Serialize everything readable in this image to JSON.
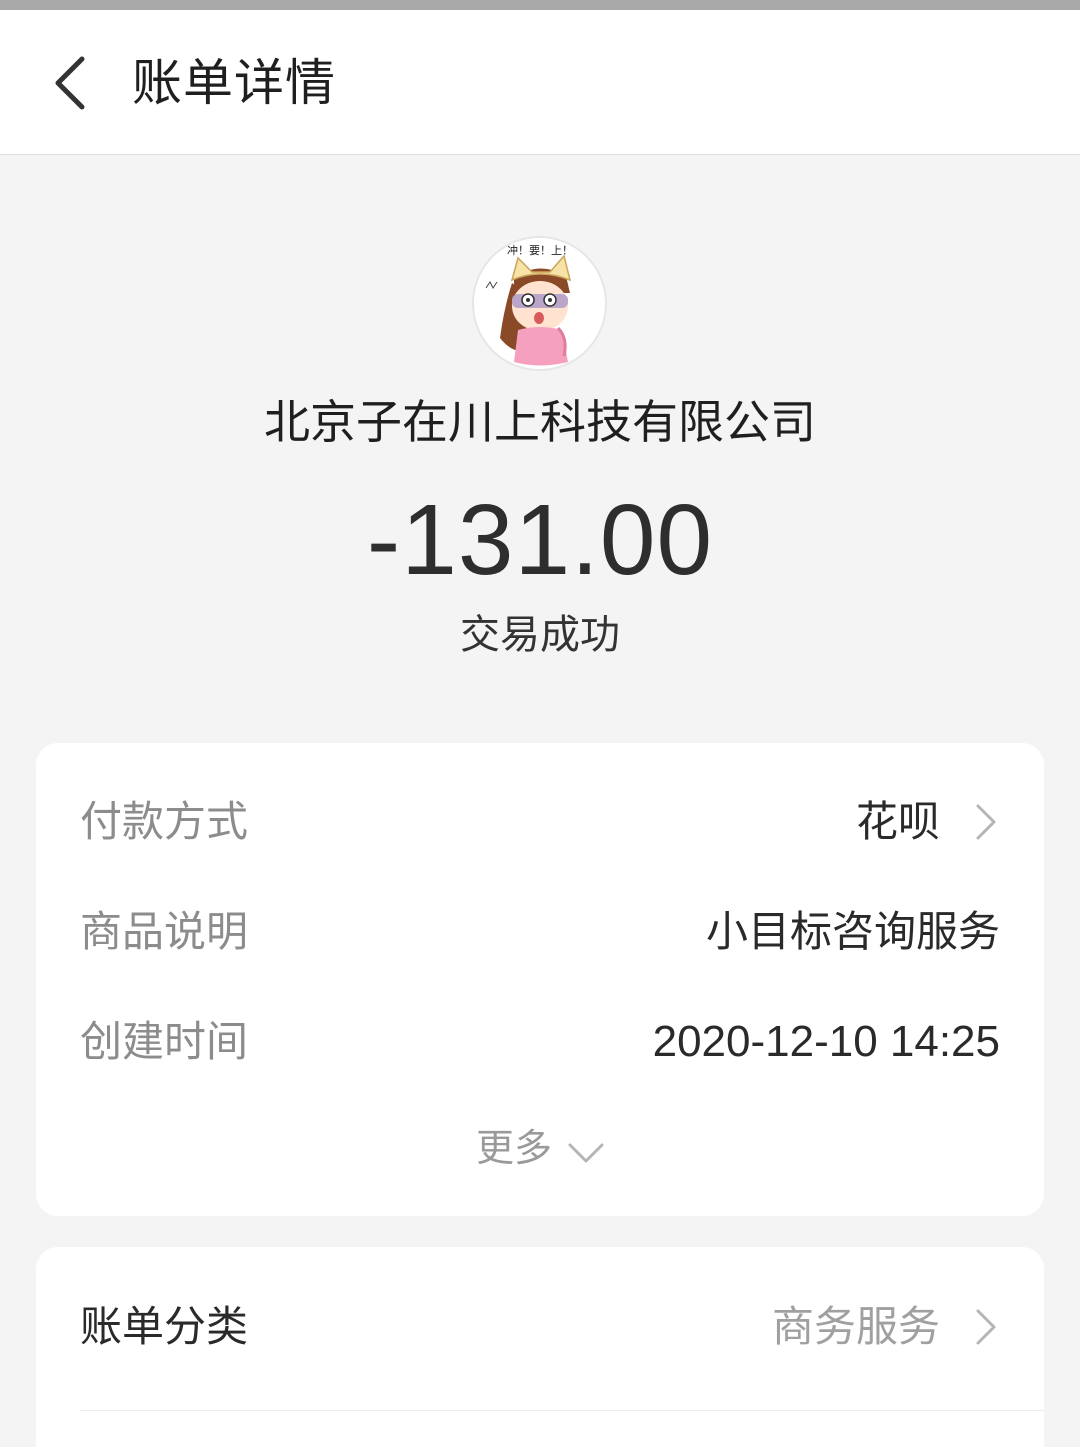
{
  "header": {
    "title": "账单详情",
    "back_icon": "chevron-left-icon"
  },
  "merchant": {
    "avatar_icon": "cartoon-avatar",
    "avatar_text": "冲！要！上！",
    "name": "北京子在川上科技有限公司"
  },
  "transaction": {
    "amount": "-131.00",
    "status": "交易成功"
  },
  "details": {
    "rows": [
      {
        "label": "付款方式",
        "value": "花呗",
        "has_chevron": true
      },
      {
        "label": "商品说明",
        "value": "小目标咨询服务",
        "has_chevron": false
      },
      {
        "label": "创建时间",
        "value": "2020-12-10 14:25",
        "has_chevron": false
      }
    ],
    "more_label": "更多"
  },
  "category": {
    "label": "账单分类",
    "value": "商务服务"
  },
  "colors": {
    "background": "#f4f4f4",
    "card": "#ffffff",
    "label_gray": "#8c8c8c",
    "text_dark": "#2a2a2a"
  }
}
